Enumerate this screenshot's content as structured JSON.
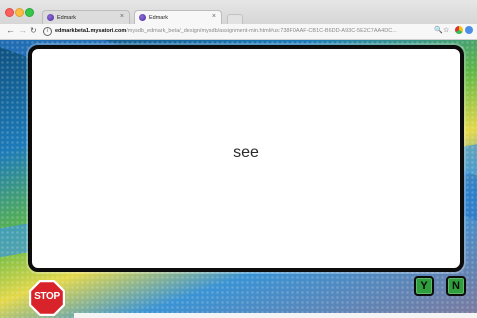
{
  "browser": {
    "tabs": [
      {
        "title": "Edmark",
        "close": "×",
        "active": false
      },
      {
        "title": "Edmark",
        "close": "×",
        "active": true
      }
    ],
    "address_host": "edmarkbeta1.mysatori.com",
    "address_path": "/mysdb_edmark_beta/_design/mysdb/assignment-min.html#us:738F0AAF-CB1C-B6DD-A93C-5E2C7AA4DC...",
    "nav_icons": {
      "back": "←",
      "forward": "→",
      "reload": "↻",
      "info": "i"
    },
    "toolbar_icons": {
      "search": "🔍",
      "star": "☆"
    }
  },
  "game": {
    "word": "see",
    "stop_label": "STOP",
    "yes_label": "Y",
    "no_label": "N",
    "colors": {
      "stop": "#d8232a",
      "key": "#2f9e3c",
      "card_border": "#0c0c0c"
    }
  }
}
